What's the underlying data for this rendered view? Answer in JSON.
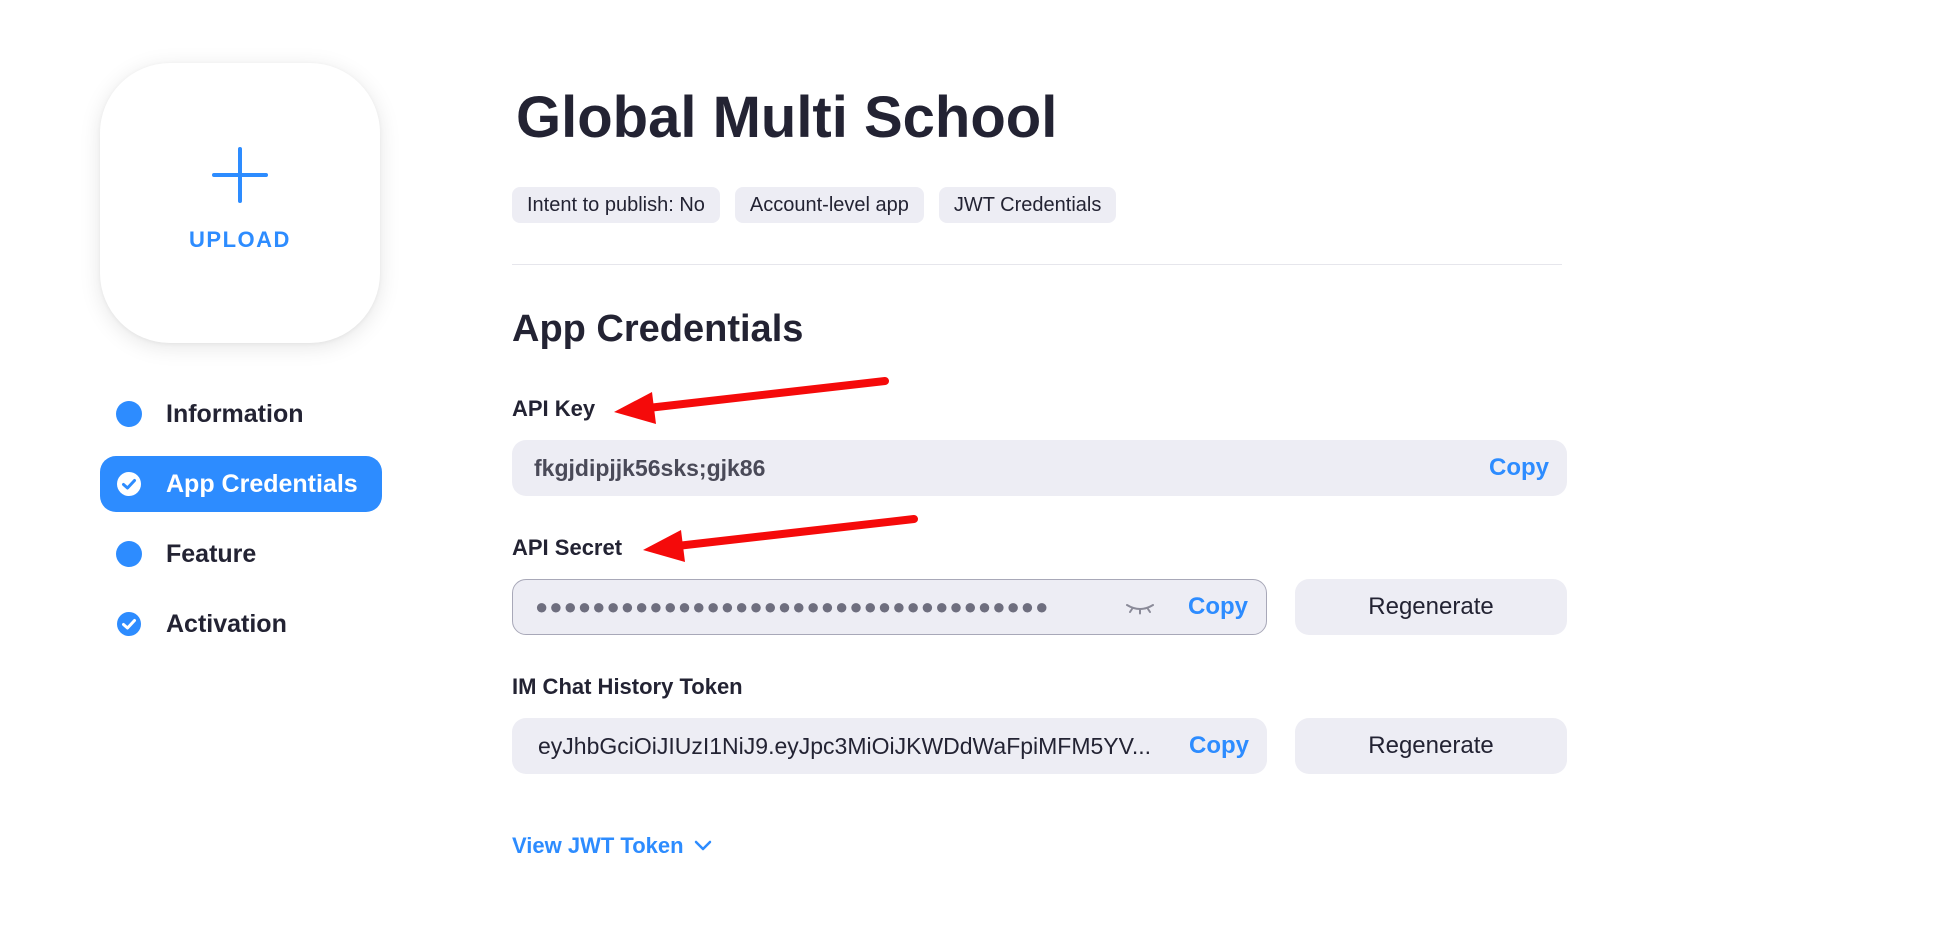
{
  "upload": {
    "label": "UPLOAD",
    "icon": "plus-icon"
  },
  "steps": [
    {
      "label": "Information",
      "icon": "dot-icon",
      "active": false
    },
    {
      "label": "App Credentials",
      "icon": "check-circle-icon",
      "active": true
    },
    {
      "label": "Feature",
      "icon": "dot-icon",
      "active": false
    },
    {
      "label": "Activation",
      "icon": "check-circle-icon",
      "active": false
    }
  ],
  "app": {
    "title": "Global Multi School",
    "tags": [
      "Intent to publish: No",
      "Account-level app",
      "JWT Credentials"
    ]
  },
  "credentials": {
    "section_title": "App Credentials",
    "api_key": {
      "label": "API Key",
      "value": "fkgjdipjjk56sks;gjk86",
      "copy_label": "Copy"
    },
    "api_secret": {
      "label": "API Secret",
      "value": "●●●●●●●●●●●●●●●●●●●●●●●●●●●●●●●●●●●●",
      "copy_label": "Copy",
      "regenerate_label": "Regenerate"
    },
    "im_chat_token": {
      "label": "IM Chat History Token",
      "value": "eyJhbGciOiJIUzI1NiJ9.eyJpc3MiOiJKWDdWaFpiMFM5YV...",
      "copy_label": "Copy",
      "regenerate_label": "Regenerate"
    },
    "view_jwt": {
      "label": "View JWT Token",
      "icon": "chevron-down-icon"
    }
  },
  "colors": {
    "accent": "#2D8CFF",
    "field_bg": "#EDEDF4",
    "text": "#232333",
    "annotation_arrow": "#F50A0A"
  }
}
